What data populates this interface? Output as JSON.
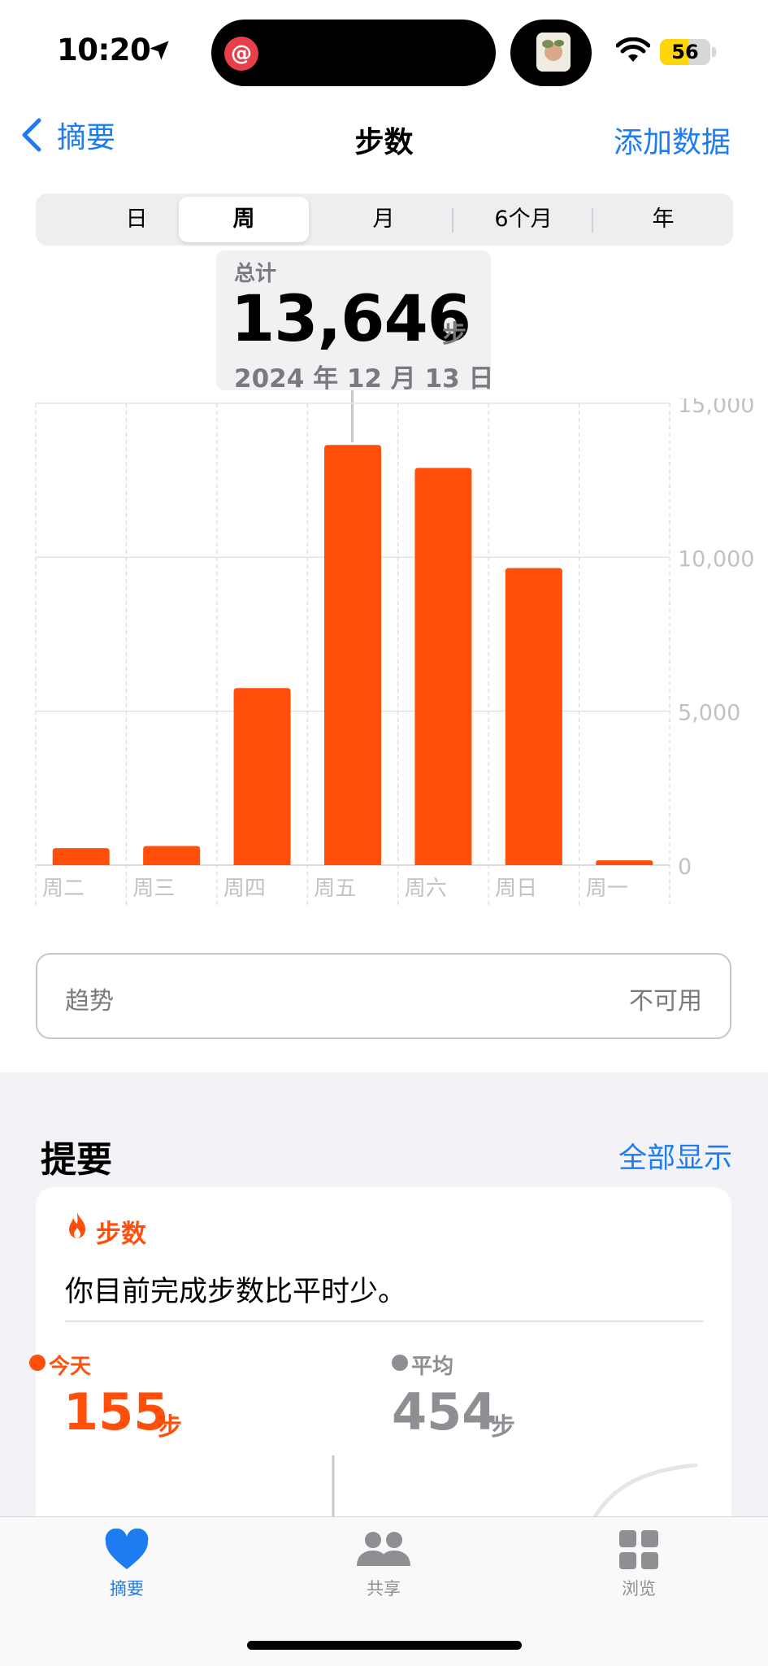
{
  "status_bar": {
    "time": "10:20",
    "battery": "56",
    "battery_level": 0.56,
    "live_activity_app": "netease-music-icon"
  },
  "nav": {
    "back_label": "摘要",
    "title": "步数",
    "add_label": "添加数据"
  },
  "segments": {
    "items": [
      "日",
      "周",
      "月",
      "6个月",
      "年"
    ],
    "selected": "周"
  },
  "callout": {
    "label": "总计",
    "value": "13,646",
    "unit": "步",
    "date": "2024 年 12 月 13 日"
  },
  "chart_data": {
    "type": "bar",
    "categories": [
      "周二",
      "周三",
      "周四",
      "周五",
      "周六",
      "周日",
      "周一"
    ],
    "values": [
      550,
      620,
      5750,
      13646,
      12900,
      9650,
      155
    ],
    "highlighted_category": "周五",
    "ylim": [
      0,
      15000
    ],
    "yticks": [
      0,
      5000,
      10000,
      15000
    ],
    "ytick_labels": [
      "0",
      "5,000",
      "10,000",
      "15,000"
    ],
    "grid": true,
    "bar_color": "#ff4f0b"
  },
  "trend": {
    "label": "趋势",
    "value": "不可用"
  },
  "highlights": {
    "title": "提要",
    "show_all": "全部显示",
    "card": {
      "category": "步数",
      "message": "你目前完成步数比平时少。",
      "today_label": "今天",
      "today_value": "155",
      "today_unit": "步",
      "average_label": "平均",
      "average_value": "454",
      "average_unit": "步"
    }
  },
  "tab_bar": {
    "items": [
      {
        "label": "摘要",
        "icon": "heart-icon",
        "active": true
      },
      {
        "label": "共享",
        "icon": "people-icon",
        "active": false
      },
      {
        "label": "浏览",
        "icon": "grid-icon",
        "active": false
      }
    ]
  },
  "colors": {
    "accent": "#1e7cf1",
    "steps": "#ff4f0b",
    "secondary_text": "#8e8e93"
  }
}
